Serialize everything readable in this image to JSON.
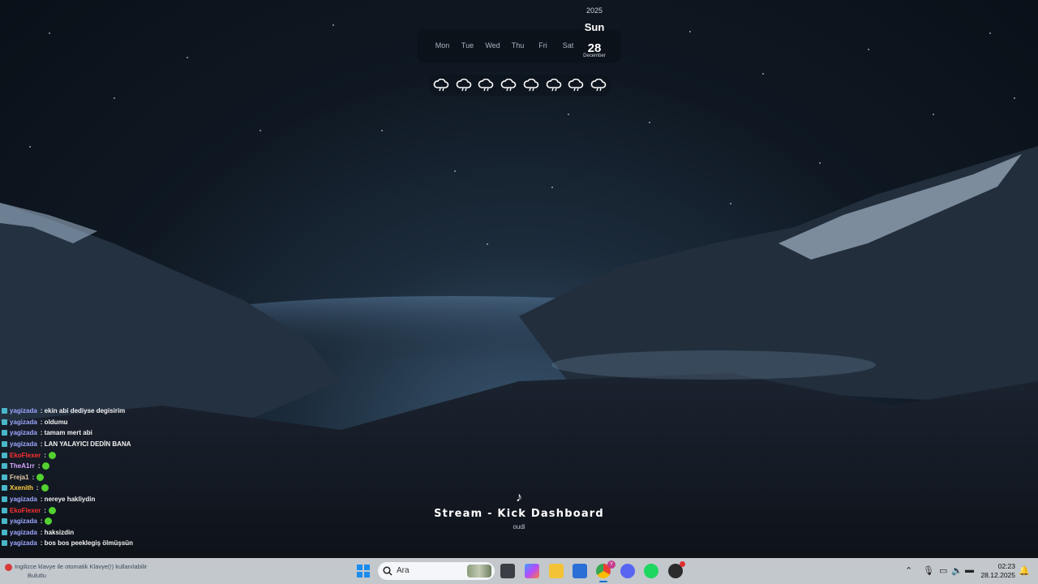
{
  "calendar": {
    "year": "2025",
    "weekdays": [
      "Mon",
      "Tue",
      "Wed",
      "Thu",
      "Fri",
      "Sat"
    ],
    "today_name": "Sun",
    "today_date": "28",
    "today_month": "December"
  },
  "weather": {
    "icon": "cloud-rain-icon",
    "count": 8
  },
  "chat": {
    "messages": [
      {
        "user": "yagizada",
        "text": ": ekin abi dediyse degisirim",
        "color": "#9ea7ff"
      },
      {
        "user": "yagizada",
        "text": ": oldumu",
        "color": "#9ea7ff"
      },
      {
        "user": "yagizada",
        "text": ": tamam mert abi",
        "color": "#9ea7ff"
      },
      {
        "user": "yagizada",
        "text": ": LAN YALAYICI DEDİN BANA",
        "color": "#9ea7ff"
      },
      {
        "user": "EkoFlexer",
        "text": ":",
        "color": "#ff3030",
        "emote": true
      },
      {
        "user": "TheA1rr",
        "text": ":",
        "color": "#d9a6ff",
        "emote": true
      },
      {
        "user": "Freja1",
        "text": ":",
        "color": "#e6c9a6",
        "emote": true
      },
      {
        "user": "Xxenith",
        "text": ":",
        "color": "#ffd040",
        "emote": true
      },
      {
        "user": "yagizada",
        "text": ": nereye hakliydin",
        "color": "#9ea7ff"
      },
      {
        "user": "EkoFlexer",
        "text": ":",
        "color": "#ff3030",
        "emote": true
      },
      {
        "user": "yagizada",
        "text": ":",
        "color": "#9ea7ff",
        "emote": true
      },
      {
        "user": "yagizada",
        "text": ": haksizdin",
        "color": "#9ea7ff"
      },
      {
        "user": "yagizada",
        "text": ": bos bos peeklegiş ölmüşsün",
        "color": "#9ea7ff"
      }
    ]
  },
  "media": {
    "title": "Stream - Kick Dashboard",
    "artist": "oudi"
  },
  "taskbar": {
    "notification_line1": "Ingilizce klavye ile otomatik Klavye(!) kullanılabilir",
    "notification_line2": "Bulutlu",
    "search_placeholder": "Ara",
    "chrome_badge": "Y",
    "time": "02:23",
    "date": "28.12.2025"
  }
}
